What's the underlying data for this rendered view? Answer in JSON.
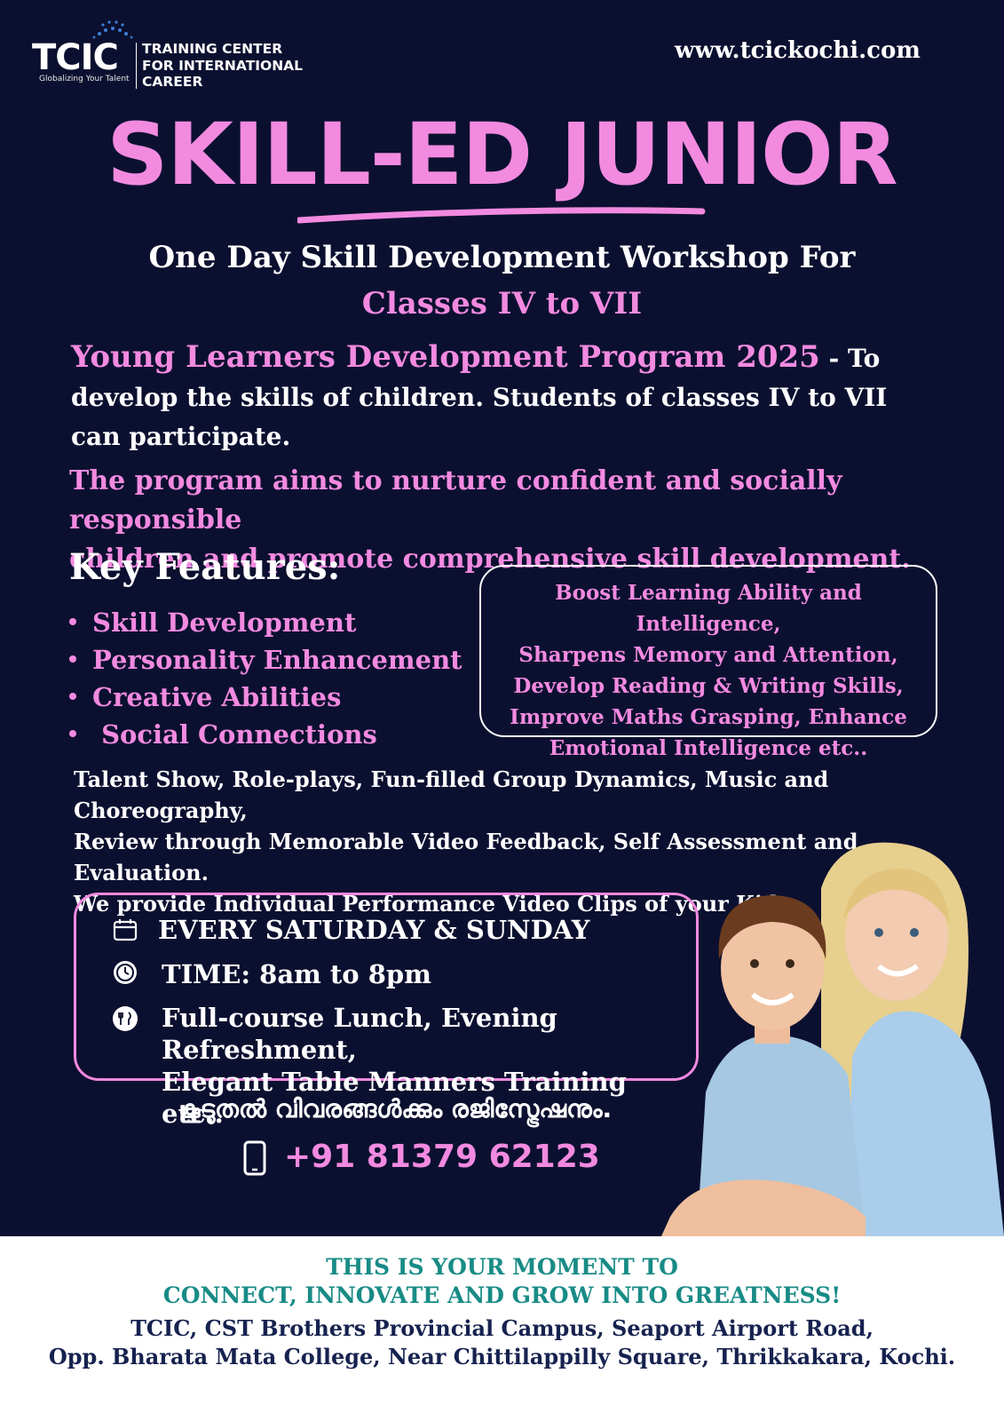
{
  "header": {
    "logo_mark": "TCIC",
    "logo_tagline": "Globalizing Your Talent",
    "logo_name_lines": [
      "TRAINING CENTER",
      "FOR INTERNATIONAL",
      "CAREER"
    ],
    "website": "www.tcickochi.com"
  },
  "title": "SKILL-ED JUNIOR",
  "subtitle_line1": "One Day Skill Development Workshop For",
  "subtitle_line2": "Classes IV to VII",
  "program": {
    "name": "Young Learners Development Program 2025",
    "desc_lead": " - To",
    "desc_line2": "develop the skills of children. Students of classes IV to VII",
    "desc_line3": "can participate."
  },
  "aim_line1": "The program aims to nurture confident and socially responsible",
  "aim_line2": "children and promote comprehensive skill development.",
  "key_features": {
    "title": "Key Features:",
    "items": [
      "Skill Development",
      "Personality Enhancement",
      "Creative Abilities",
      " Social Connections"
    ]
  },
  "benefits_lines": [
    "Boost Learning Ability and Intelligence,",
    "Sharpens Memory and Attention,",
    "Develop Reading  & Writing  Skills,",
    "Improve Maths Grasping, Enhance",
    "Emotional Intelligence  etc.."
  ],
  "activities_lines": [
    "Talent Show, Role-plays, Fun-filled Group Dynamics, Music and Choreography,",
    "Review through Memorable Video Feedback, Self Assessment and Evaluation.",
    "We provide Individual Performance Video Clips of your Kids."
  ],
  "schedule": {
    "days": "EVERY SATURDAY & SUNDAY",
    "time": "TIME: 8am to 8pm",
    "meals_line1": "Full-course Lunch, Evening Refreshment,",
    "meals_line2": "Elegant Table Manners Training etc.."
  },
  "contact": {
    "malayalam_note": "കൂടുതൽ വിവരങ്ങൾക്കും രജിസ്ട്രേഷനും.",
    "phone": "+91 81379 62123"
  },
  "footer": {
    "slogan_line1": "THIS IS YOUR MOMENT TO",
    "slogan_line2": "CONNECT, INNOVATE AND GROW INTO GREATNESS!",
    "address_line1": "TCIC, CST Brothers Provincial Campus, Seaport Airport Road,",
    "address_line2": "Opp. Bharata Mata College, Near Chittilappilly Square, Thrikkakara, Kochi."
  },
  "colors": {
    "background": "#0c1030",
    "accent_pink": "#f28ae0",
    "footer_teal": "#188b86",
    "footer_navy": "#16224f"
  }
}
